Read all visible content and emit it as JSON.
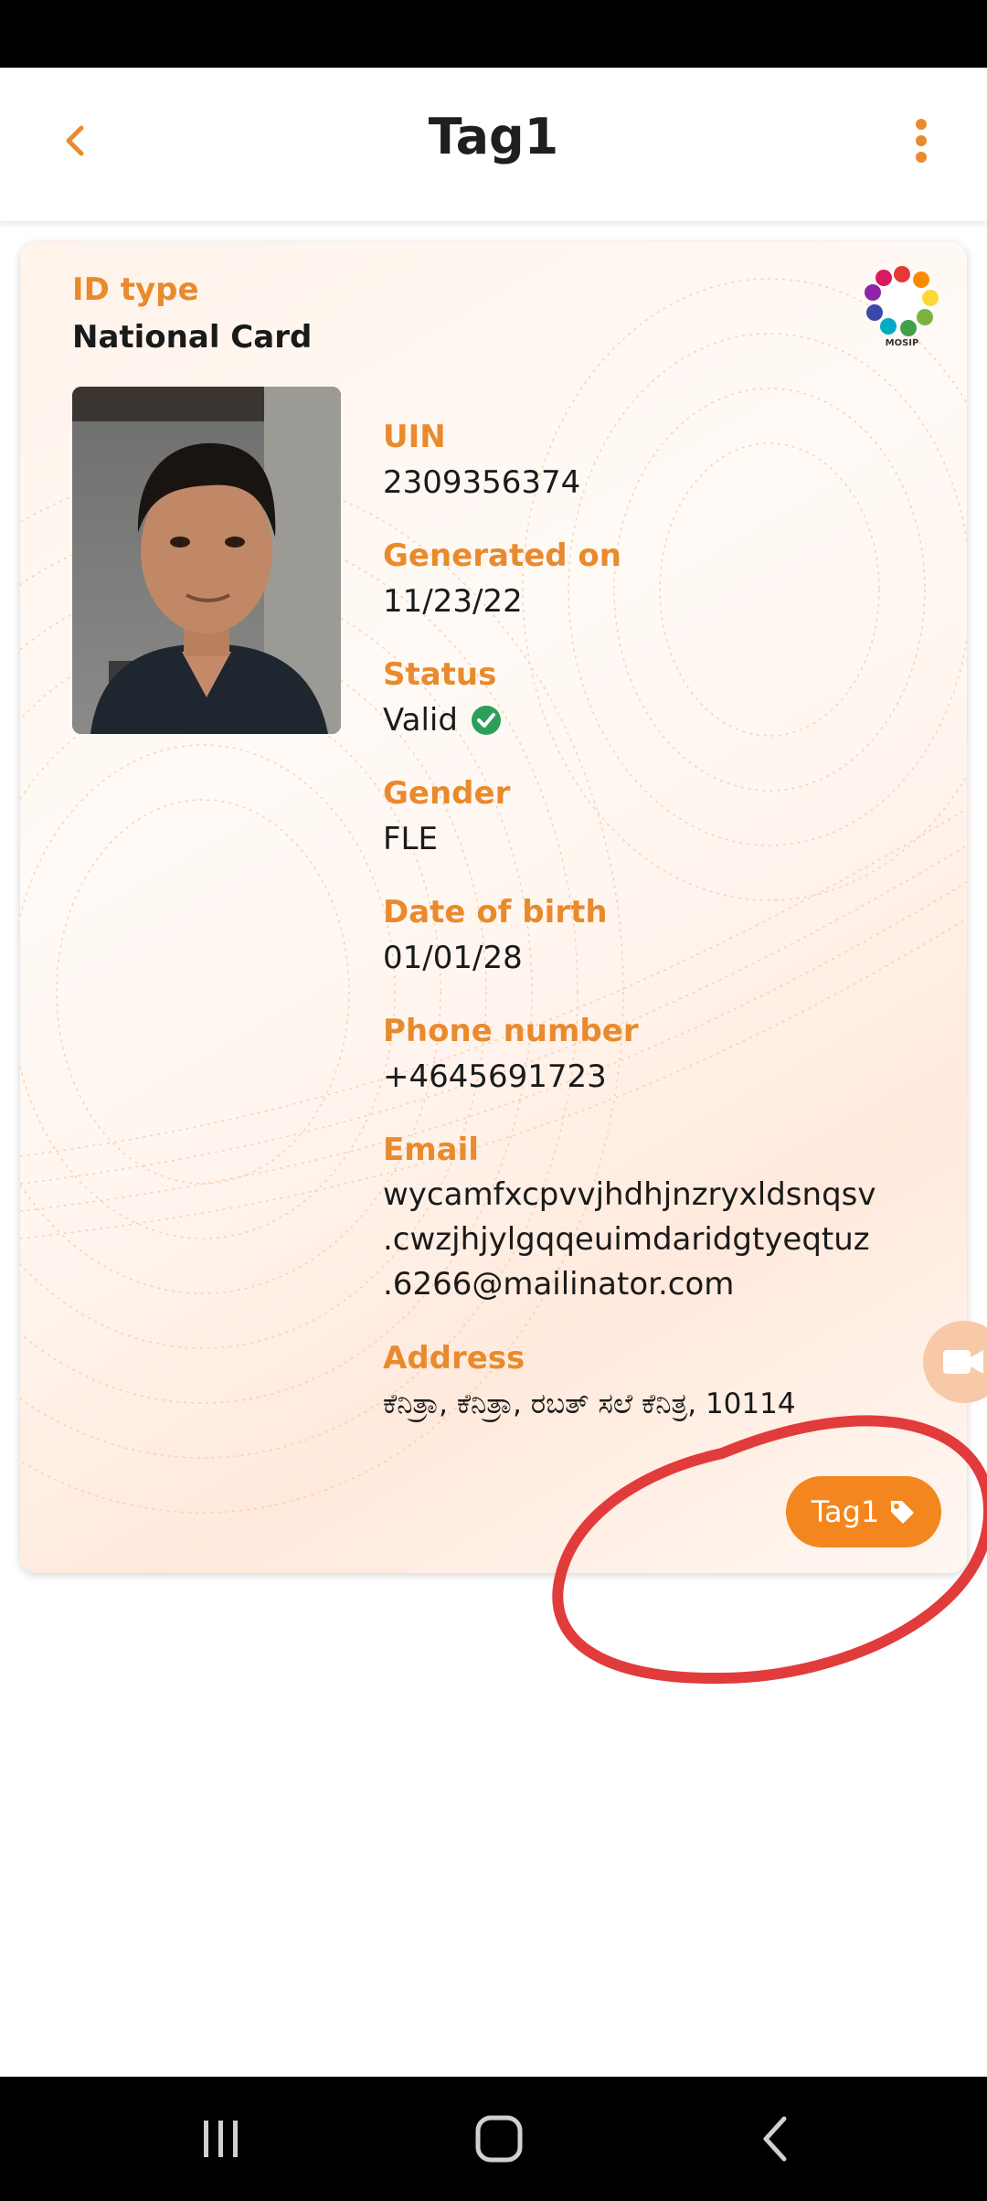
{
  "app_bar": {
    "title": "Tag1",
    "back_icon": "chevron-left-icon",
    "menu_icon": "kebab-menu-icon"
  },
  "card": {
    "id_type_label": "ID type",
    "id_type_value": "National Card",
    "logo_text": "MOSIP",
    "fields": {
      "uin": {
        "label": "UIN",
        "value": "2309356374"
      },
      "generated_on": {
        "label": "Generated on",
        "value": "11/23/22"
      },
      "status": {
        "label": "Status",
        "value": "Valid"
      },
      "gender": {
        "label": "Gender",
        "value": "FLE"
      },
      "dob": {
        "label": "Date of birth",
        "value": "01/01/28"
      },
      "phone": {
        "label": "Phone number",
        "value": "+4645691723"
      },
      "email": {
        "label": "Email",
        "line1": "wycamfxcpvvjhdhjnzryxldsnqsv",
        "line2": ".cwzjhjylgqqeuimdaridgtyeqtuz",
        "line3": ".6266@mailinator.com"
      },
      "address": {
        "label": "Address",
        "value": "ಕೆನಿತ್ರಾ, ಕೆನಿತ್ರಾ, ರಬತ್ ಸಲೆ ಕೆನಿತ್ರ, 10114"
      }
    },
    "tag_chip": {
      "label": "Tag1",
      "icon": "tag-icon"
    }
  },
  "colors": {
    "accent": "#f3861e",
    "label": "#e98a2d",
    "valid": "#2e9e5b",
    "annotation": "#e23b3b"
  }
}
